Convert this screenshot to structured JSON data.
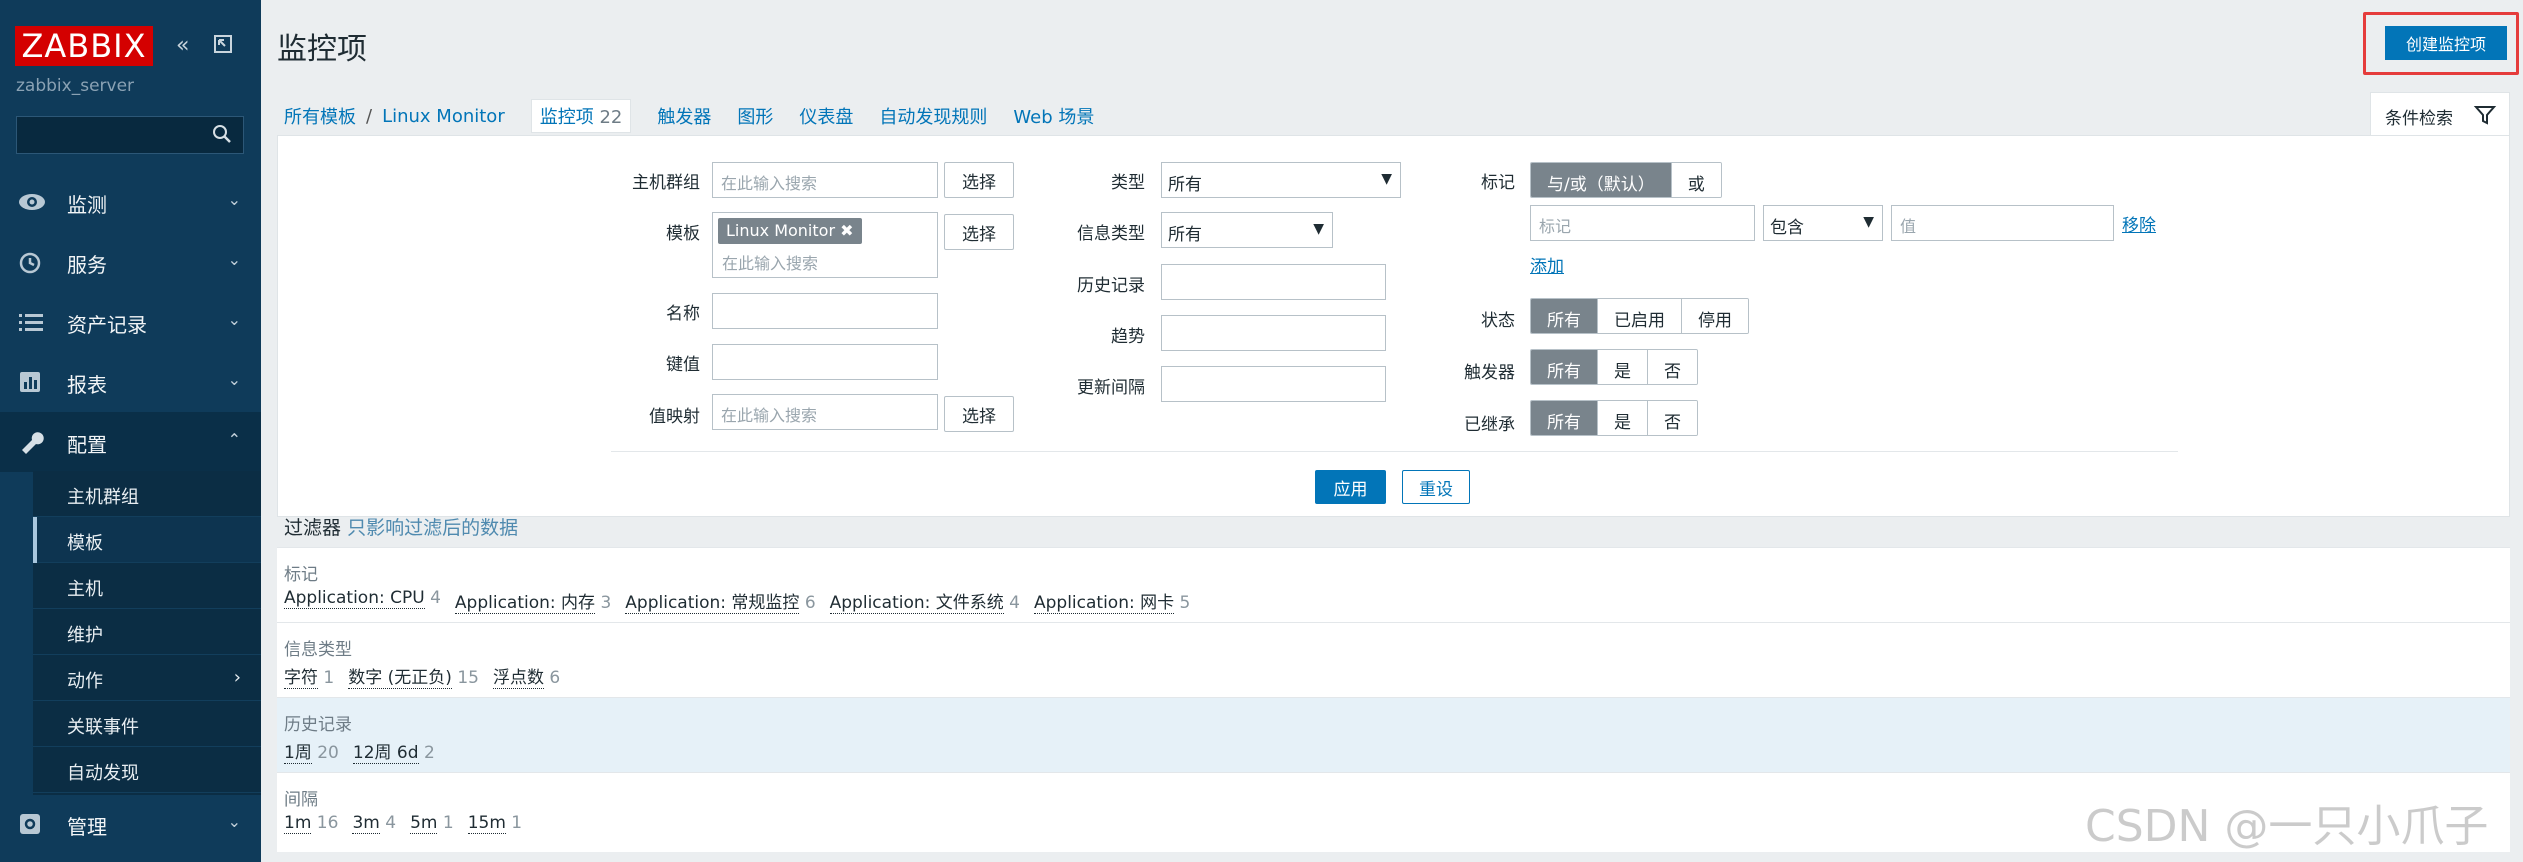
{
  "sidebar": {
    "logo": "ZABBIX",
    "server_name": "zabbix_server",
    "menu": [
      {
        "label": "监测",
        "icon": "eye-icon"
      },
      {
        "label": "服务",
        "icon": "clock-icon"
      },
      {
        "label": "资产记录",
        "icon": "list-icon"
      },
      {
        "label": "报表",
        "icon": "chart-icon"
      },
      {
        "label": "配置",
        "icon": "wrench-icon"
      },
      {
        "label": "管理",
        "icon": "gear-icon"
      }
    ],
    "submenu": [
      "主机群组",
      "模板",
      "主机",
      "维护",
      "动作",
      "关联事件",
      "自动发现"
    ]
  },
  "header": {
    "title": "监控项",
    "create_button": "创建监控项"
  },
  "breadcrumb": {
    "root": "所有模板",
    "separator": "/",
    "template": "Linux Monitor",
    "tabs": [
      {
        "label": "监控项",
        "count": "22"
      },
      {
        "label": "触发器"
      },
      {
        "label": "图形"
      },
      {
        "label": "仪表盘"
      },
      {
        "label": "自动发现规则"
      },
      {
        "label": "Web 场景"
      }
    ]
  },
  "filter": {
    "tab_label": "条件检索",
    "host_group_label": "主机群组",
    "template_label": "模板",
    "name_label": "名称",
    "key_label": "键值",
    "valuemap_label": "值映射",
    "placeholder": "在此输入搜索",
    "select_button": "选择",
    "template_chip": "Linux Monitor",
    "type_label": "类型",
    "type_value": "所有",
    "info_type_label": "信息类型",
    "info_type_value": "所有",
    "history_label": "历史记录",
    "trends_label": "趋势",
    "update_interval_label": "更新间隔",
    "tags_label": "标记",
    "tags_andor": "与/或（默认）",
    "tags_or": "或",
    "tag_placeholder": "标记",
    "tag_operator": "包含",
    "value_placeholder": "值",
    "remove_link": "移除",
    "add_link": "添加",
    "state_label": "状态",
    "state_options": [
      "所有",
      "已启用",
      "停用"
    ],
    "triggers_label": "触发器",
    "triggers_options": [
      "所有",
      "是",
      "否"
    ],
    "inherited_label": "已继承",
    "inherited_options": [
      "所有",
      "是",
      "否"
    ],
    "apply_button": "应用",
    "reset_button": "重设"
  },
  "subfilter": {
    "title": "过滤器",
    "note": "只影响过滤后的数据",
    "sections": [
      {
        "title": "标记",
        "items": [
          {
            "name": "Application: CPU",
            "count": "4"
          },
          {
            "name": "Application: 内存",
            "count": "3"
          },
          {
            "name": "Application: 常规监控",
            "count": "6"
          },
          {
            "name": "Application: 文件系统",
            "count": "4"
          },
          {
            "name": "Application: 网卡",
            "count": "5"
          }
        ]
      },
      {
        "title": "信息类型",
        "items": [
          {
            "name": "字符",
            "count": "1"
          },
          {
            "name": "数字 (无正负)",
            "count": "15"
          },
          {
            "name": "浮点数",
            "count": "6"
          }
        ]
      },
      {
        "title": "历史记录",
        "items": [
          {
            "name": "1周",
            "count": "20"
          },
          {
            "name": "12周 6d",
            "count": "2"
          }
        ]
      },
      {
        "title": "间隔",
        "items": [
          {
            "name": "1m",
            "count": "16"
          },
          {
            "name": "3m",
            "count": "4"
          },
          {
            "name": "5m",
            "count": "1"
          },
          {
            "name": "15m",
            "count": "1"
          }
        ]
      }
    ]
  },
  "watermark": "CSDN @一只小爪子"
}
